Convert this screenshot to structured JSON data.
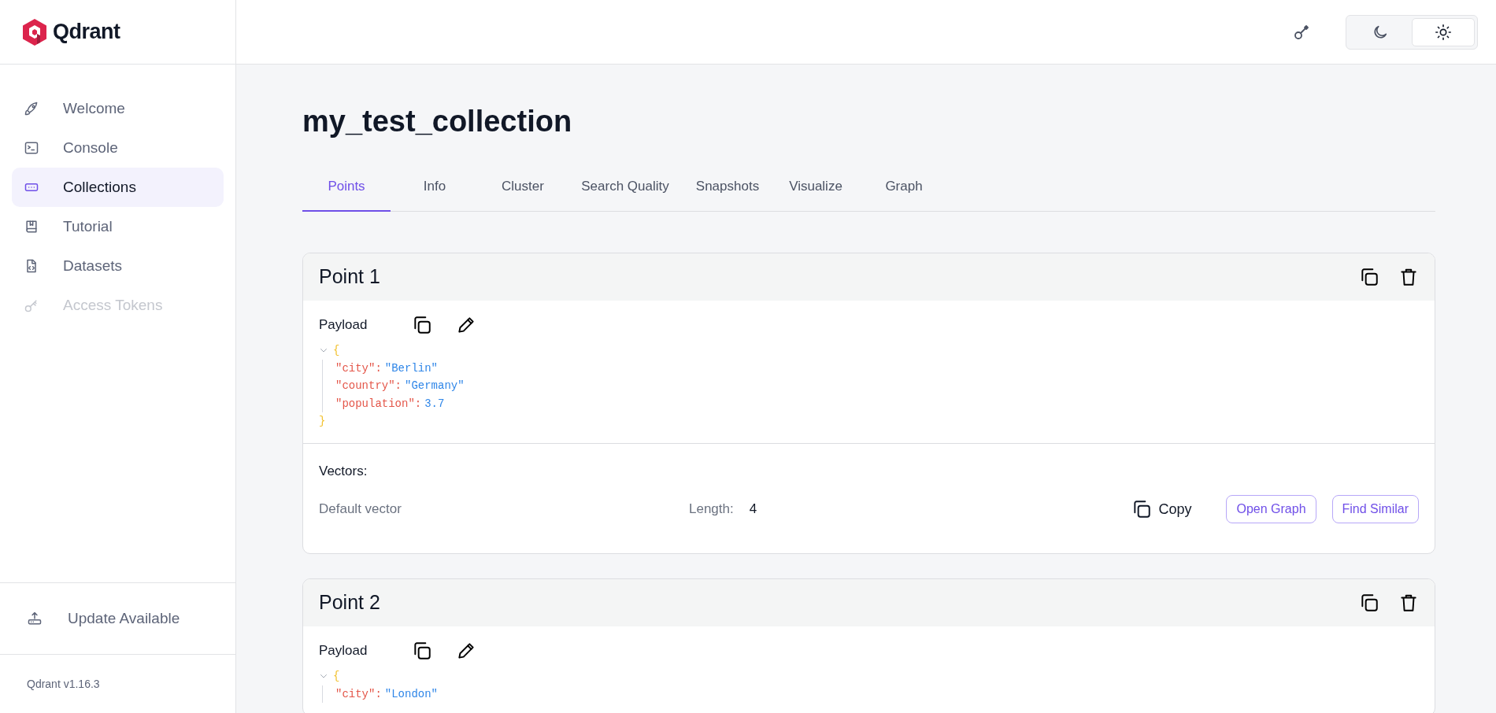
{
  "brand": {
    "name": "Qdrant"
  },
  "sidebar": {
    "items": [
      {
        "label": "Welcome",
        "selected": false,
        "disabled": false
      },
      {
        "label": "Console",
        "selected": false,
        "disabled": false
      },
      {
        "label": "Collections",
        "selected": true,
        "disabled": false
      },
      {
        "label": "Tutorial",
        "selected": false,
        "disabled": false
      },
      {
        "label": "Datasets",
        "selected": false,
        "disabled": false
      },
      {
        "label": "Access Tokens",
        "selected": false,
        "disabled": true
      }
    ],
    "update": "Update Available",
    "version": "Qdrant v1.16.3"
  },
  "header": {
    "theme": [
      {
        "kind": "dark",
        "selected": false
      },
      {
        "kind": "light",
        "selected": true
      }
    ]
  },
  "title": "my_test_collection",
  "tabs": [
    {
      "label": "Points",
      "selected": true
    },
    {
      "label": "Info",
      "selected": false
    },
    {
      "label": "Cluster",
      "selected": false
    },
    {
      "label": "Search Quality",
      "selected": false
    },
    {
      "label": "Snapshots",
      "selected": false
    },
    {
      "label": "Visualize",
      "selected": false
    },
    {
      "label": "Graph",
      "selected": false
    }
  ],
  "points": [
    {
      "title": "Point 1",
      "payload_label": "Payload",
      "expanded": true,
      "open": "{",
      "close": "}",
      "payload": [
        {
          "key": "\"city\":",
          "value": "\"Berlin\""
        },
        {
          "key": "\"country\":",
          "value": "\"Germany\""
        },
        {
          "key": "\"population\":",
          "value": "3.7"
        }
      ],
      "vectors_label": "Vectors:",
      "vectors": [
        {
          "name": "Default vector",
          "length_label": "Length:",
          "length": "4",
          "copy": "Copy",
          "buttons": [
            "Open Graph",
            "Find Similar"
          ]
        }
      ]
    },
    {
      "title": "Point 2",
      "payload_label": "Payload",
      "expanded": true,
      "open": "{",
      "payload": [
        {
          "key": "\"city\":",
          "value": "\"London\""
        }
      ]
    }
  ]
}
